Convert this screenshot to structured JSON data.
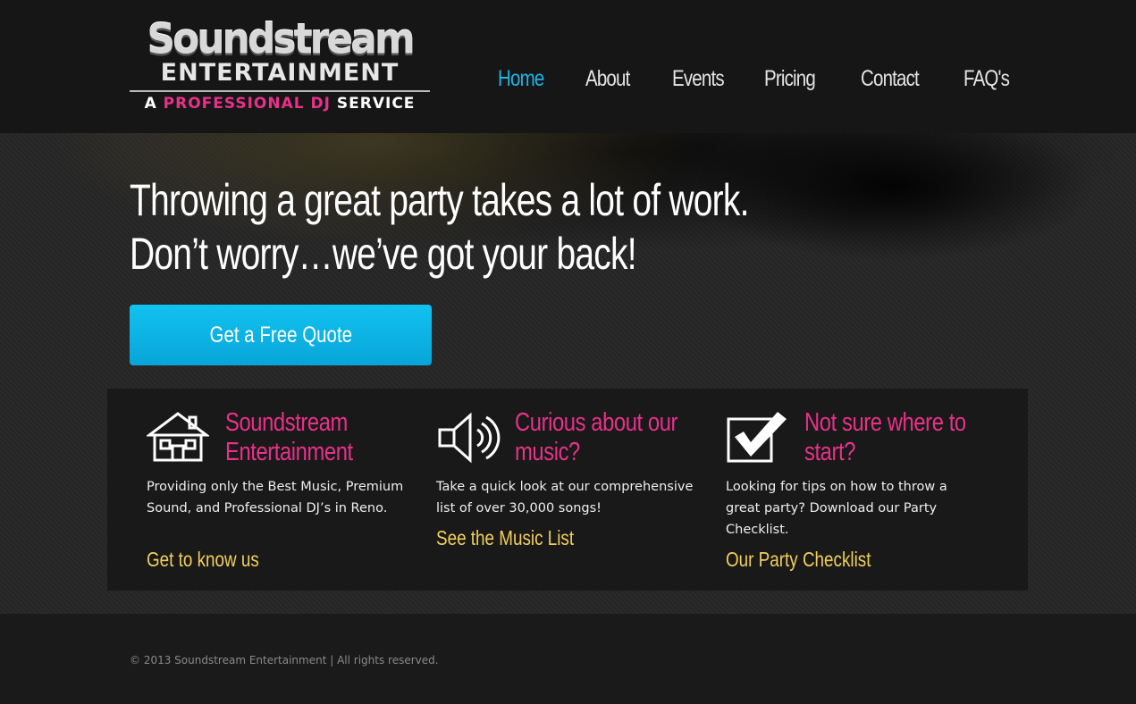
{
  "brand": {
    "line1": "Soundstream",
    "line2": "ENTERTAINMENT",
    "tagline_a": "A",
    "tagline_pro": "PROFESSIONAL DJ",
    "tagline_service": "SERVICE"
  },
  "nav": {
    "items": [
      {
        "label": "Home",
        "active": true
      },
      {
        "label": "About"
      },
      {
        "label": "Events"
      },
      {
        "label": "Pricing"
      },
      {
        "label": "Contact"
      },
      {
        "label": "FAQ's"
      }
    ]
  },
  "hero": {
    "line1": "Throwing a great party takes a lot of work.",
    "line2": "Don’t worry…we’ve got your back!",
    "cta": "Get a Free Quote"
  },
  "features": [
    {
      "icon": "house-icon",
      "title": "Soundstream Entertainment",
      "text": "Providing only the Best Music, Premium Sound, and Professional DJ’s in Reno.",
      "link": "Get to know us"
    },
    {
      "icon": "speaker-icon",
      "title": "Curious about our music?",
      "text": "Take a quick look at our comprehensive list of over 30,000 songs!",
      "link": "See the Music List"
    },
    {
      "icon": "checkbox-icon",
      "title": "Not sure where to start?",
      "text": "Looking for tips on how to throw a great party? Download our Party Checklist.",
      "link": "Our Party Checklist"
    }
  ],
  "footer": {
    "copyright": "© 2013 Soundstream Entertainment | All rights reserved."
  },
  "colors": {
    "accent_blue": "#1fb3e6",
    "accent_pink": "#e8318a",
    "link_yellow": "#f2cf5b"
  }
}
